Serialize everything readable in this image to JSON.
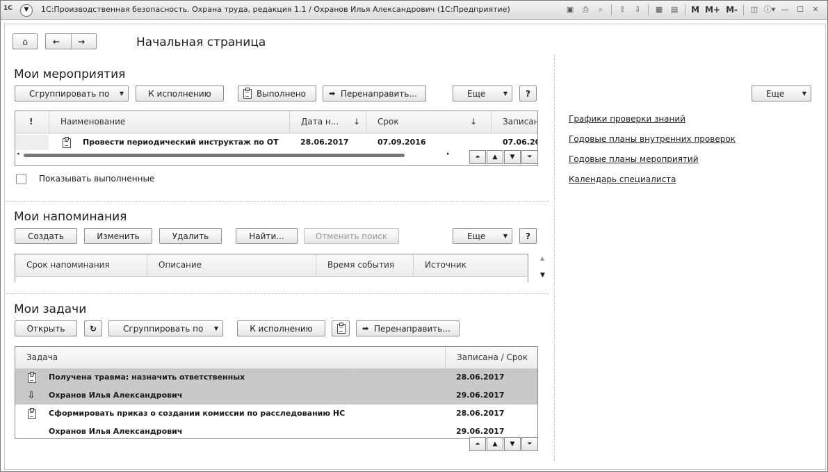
{
  "window": {
    "logo": "1С",
    "title": "1С:Производственная безопасность. Охрана труда, редакция 1.1 / Охранов Илья Александрович  (1С:Предприятие)",
    "toolbar_text": [
      "M",
      "M+",
      "M-"
    ]
  },
  "page": {
    "title": "Начальная страница"
  },
  "events": {
    "heading": "Мои мероприятия",
    "group_by_label": "Сгруппировать по",
    "execute_label": "К исполнению",
    "done_label": "Выполнено",
    "redirect_label": "Перенаправить...",
    "more_label": "Еще",
    "help_label": "?",
    "columns": [
      "!",
      "Наименование",
      "Дата н...",
      "Срок",
      "Записан"
    ],
    "rows": [
      {
        "name": "Провести периодический инструктаж по ОТ",
        "date": "28.06.2017",
        "deadline": "07.09.2016",
        "recorded": "07.06.20"
      }
    ],
    "show_done_label": "Показывать выполненные",
    "show_done_checked": false
  },
  "reminders": {
    "heading": "Мои напоминания",
    "create_label": "Создать",
    "edit_label": "Изменить",
    "delete_label": "Удалить",
    "find_label": "Найти...",
    "cancel_search_label": "Отменить поиск",
    "more_label": "Еще",
    "help_label": "?",
    "columns": [
      "Срок напоминания",
      "Описание",
      "Время события",
      "Источник"
    ]
  },
  "tasks": {
    "heading": "Мои задачи",
    "open_label": "Открыть",
    "group_by_label": "Сгруппировать по",
    "execute_label": "К исполнению",
    "redirect_label": "Перенаправить...",
    "columns": [
      "Задача",
      "Записана / Срок"
    ],
    "rows": [
      {
        "name": "Получена травма: назначить ответственных",
        "date": "28.06.2017",
        "icon": "clipboard-icon",
        "selected": true
      },
      {
        "name": "Охранов Илья Александрович",
        "date": "29.06.2017",
        "icon": "arrow-down-icon",
        "selected": true
      },
      {
        "name": "Сформировать приказ о создании комиссии по расследованию НС",
        "date": "28.06.2017",
        "icon": "clipboard-icon",
        "selected": false
      },
      {
        "name": "Охранов Илья Александрович",
        "date": "29.06.2017",
        "icon": "",
        "selected": false
      }
    ]
  },
  "sidebar": {
    "more_label": "Еще",
    "links": [
      "Графики проверки знаний",
      "Годовые планы внутренних проверок",
      "Годовые планы мероприятий",
      "Календарь специалиста"
    ]
  }
}
